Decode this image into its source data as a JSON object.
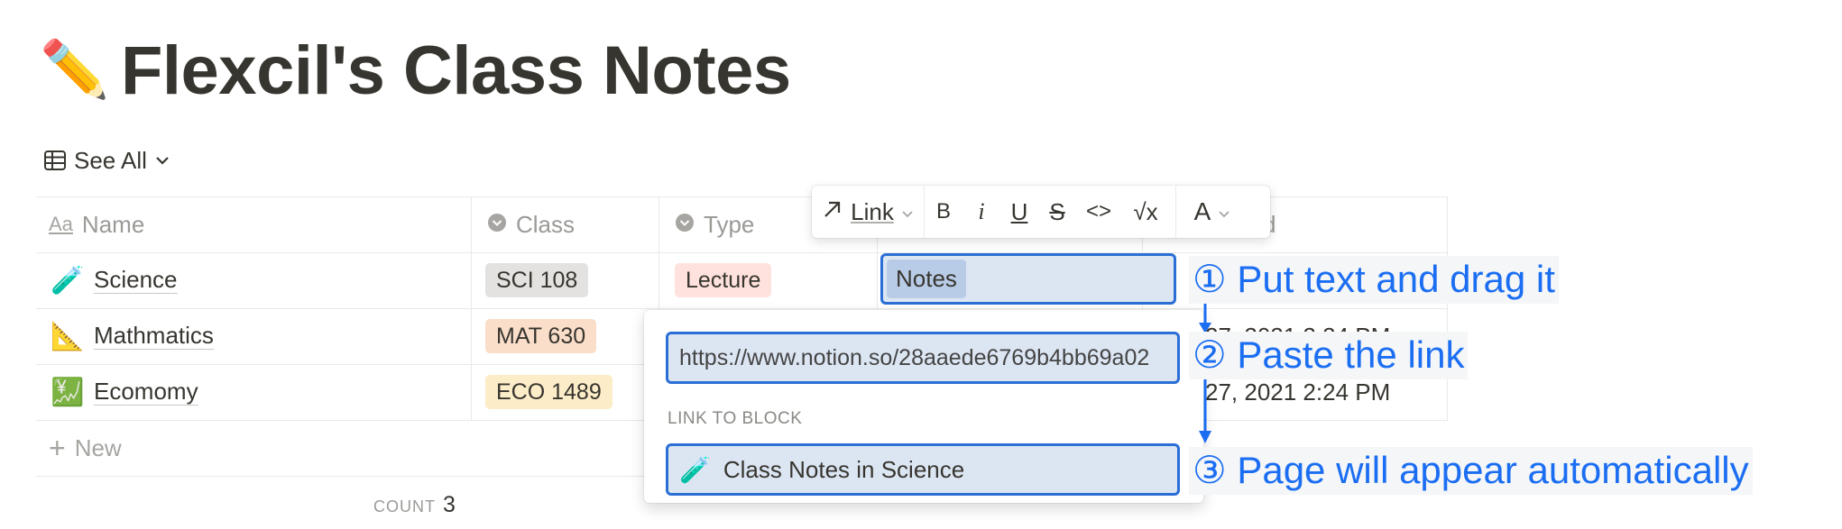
{
  "page": {
    "title": "Flexcil's Class Notes",
    "icon": "pencil-emoji",
    "icon_char": "✏️"
  },
  "view": {
    "label": "See All",
    "icon": "table-icon"
  },
  "table": {
    "columns": [
      {
        "label": "Name",
        "icon": "text-aa-icon"
      },
      {
        "label": "Class",
        "icon": "select-icon"
      },
      {
        "label": "Type",
        "icon": "select-icon"
      },
      {
        "label": "d",
        "icon": ""
      }
    ],
    "rows": [
      {
        "emoji": "🧪",
        "name": "Science",
        "class": "SCI 108",
        "class_color": "#e3e2e0",
        "type": "Lecture",
        "type_color": "#ffe2dd",
        "date": ""
      },
      {
        "emoji": "📐",
        "name": "Mathmatics",
        "class": "MAT 630",
        "class_color": "#fadec9",
        "type": "",
        "type_color": "",
        "date": "27, 2021 2:24 PM"
      },
      {
        "emoji": "💹",
        "name": "Ecomomy",
        "class": "ECO 1489",
        "class_color": "#fdecc8",
        "type": "",
        "type_color": "",
        "date": "27, 2021 2:24 PM"
      }
    ],
    "new_label": "New",
    "count_label": "COUNT",
    "count_value": "3"
  },
  "toolbar": {
    "link_label": "Link",
    "bold": "B",
    "italic": "i",
    "underline": "U",
    "strike": "S",
    "code": "<>",
    "equation": "√x",
    "color": "A"
  },
  "editing": {
    "cell_text": "Notes"
  },
  "popup": {
    "url_value": "https://www.notion.so/28aaede6769b4bb69a02",
    "section_label": "LINK TO BLOCK",
    "result_icon": "🧪",
    "result_label": "Class Notes in Science"
  },
  "annotations": [
    "① Put text and drag it",
    "② Paste the link",
    "③ Page will appear automatically"
  ],
  "colors": {
    "accent": "#2b6fd6",
    "annotation": "#1b6ef2",
    "selection_bg": "#dce6f3"
  }
}
